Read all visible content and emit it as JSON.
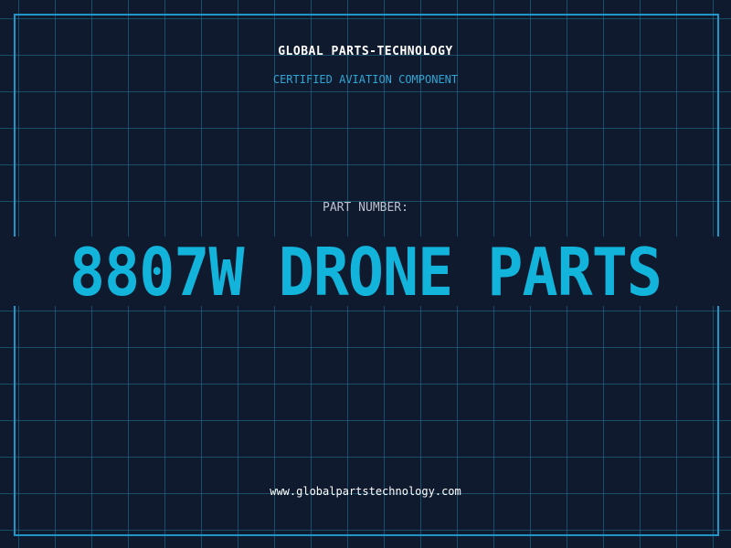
{
  "header": {
    "company": "GLOBAL PARTS-TECHNOLOGY",
    "subtitle": "CERTIFIED AVIATION COMPONENT"
  },
  "part": {
    "label": "PART NUMBER:",
    "number": "8807W DRONE PARTS"
  },
  "footer": {
    "website": "www.globalpartstechnology.com"
  },
  "colors": {
    "background": "#101a2e",
    "grid": "#227696",
    "frame": "#1f95c8",
    "accent": "#12b4dc",
    "subtitle": "#2fa7d6"
  }
}
